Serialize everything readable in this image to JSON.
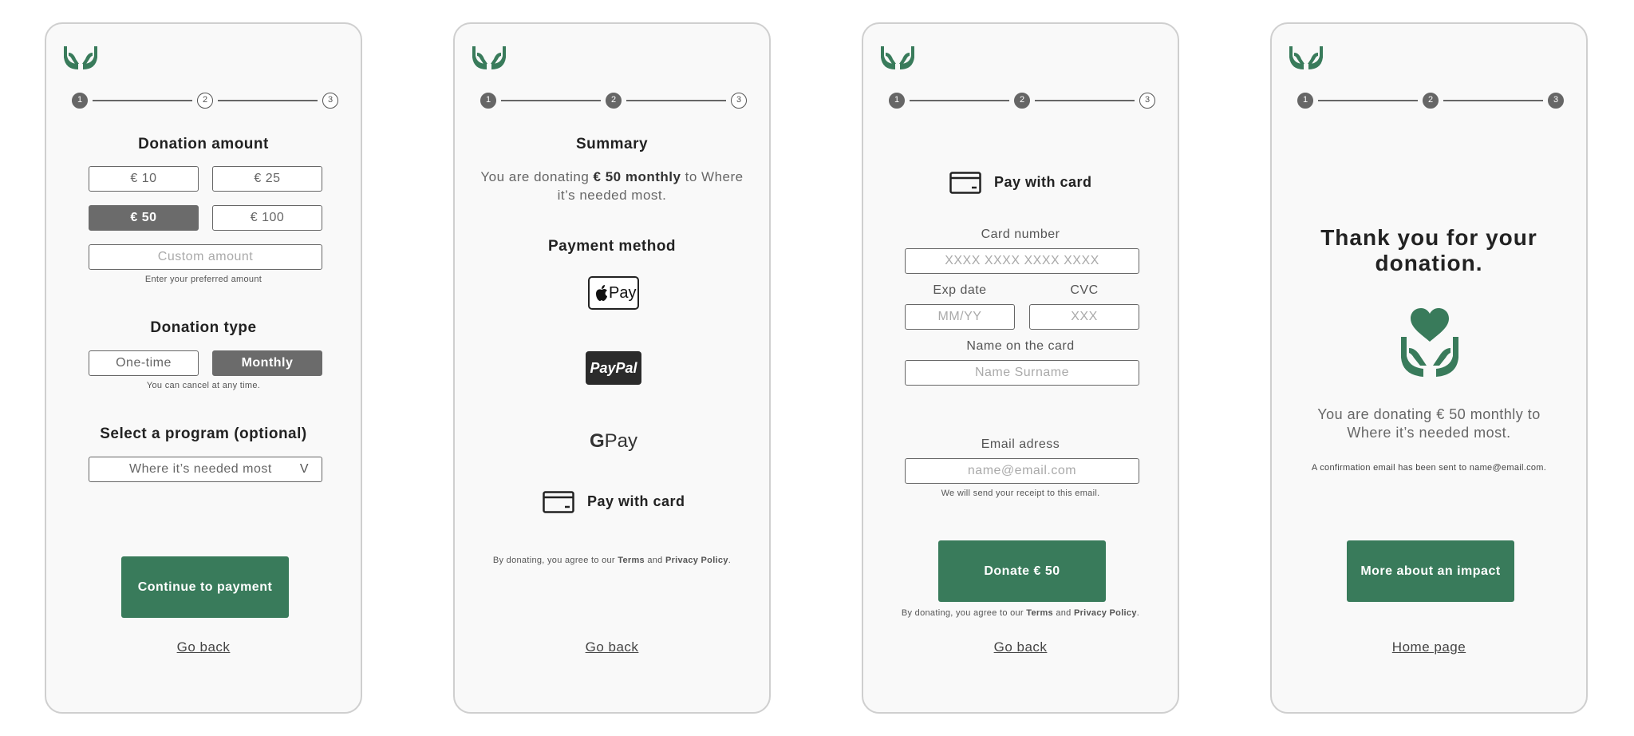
{
  "colors": {
    "brand_green": "#397b5b",
    "selected_gray": "#6b6b6b",
    "card_bg": "#f9f9f9"
  },
  "icons": [
    "hands-logo-icon",
    "credit-card-icon",
    "apple-pay-icon",
    "paypal-icon",
    "google-pay-icon",
    "heart-hands-icon",
    "chevron-down-icon"
  ],
  "steps": [
    "1",
    "2",
    "3"
  ],
  "screen1": {
    "title": "Donation amount",
    "amounts": [
      "€ 10",
      "€ 25",
      "€ 50",
      "€ 100"
    ],
    "selected_amount": "€ 50",
    "custom_placeholder": "Custom amount",
    "custom_hint": "Enter your preferred amount",
    "type_title": "Donation type",
    "types": [
      "One-time",
      "Monthly"
    ],
    "selected_type": "Monthly",
    "type_hint": "You can cancel at any time.",
    "program_title": "Select a program (optional)",
    "program_value": "Where it’s needed most",
    "chevron": "V",
    "continue_button": "Continue to payment",
    "back_link": "Go back"
  },
  "screen2": {
    "title": "Summary",
    "summary_pre": "You are donating ",
    "summary_bold": "€ 50 monthly",
    "summary_post": " to Where it’s needed most.",
    "payment_title": "Payment method",
    "apple_pay_label": "Pay",
    "paypal_label": "PayPal",
    "gpay_g": "G",
    "gpay_label": "Pay",
    "card_label": "Pay with card",
    "terms_pre": "By donating, you agree to our ",
    "terms": "Terms",
    "terms_and": " and ",
    "privacy": "Privacy Policy",
    "terms_end": ".",
    "back_link": "Go back"
  },
  "screen3": {
    "title": "Pay with card",
    "card_number_label": "Card number",
    "card_number_placeholder": "XXXX XXXX XXXX XXXX",
    "exp_label": "Exp date",
    "exp_placeholder": "MM/YY",
    "cvc_label": "CVC",
    "cvc_placeholder": "XXX",
    "name_label": "Name on the card",
    "name_placeholder": "Name Surname",
    "email_label": "Email adress",
    "email_placeholder": "name@email.com",
    "email_hint": "We will send your receipt to this email.",
    "donate_button": "Donate € 50",
    "terms_pre": "By donating, you agree to our ",
    "terms": "Terms",
    "terms_and": " and ",
    "privacy": "Privacy Policy",
    "terms_end": ".",
    "back_link": "Go back"
  },
  "screen4": {
    "title": "Thank you for your donation.",
    "summary": "You are donating € 50 monthly to Where it’s needed most.",
    "confirmation": "A confirmation email has been sent to name@email.com.",
    "impact_button": "More about an impact",
    "home_link": "Home page"
  }
}
